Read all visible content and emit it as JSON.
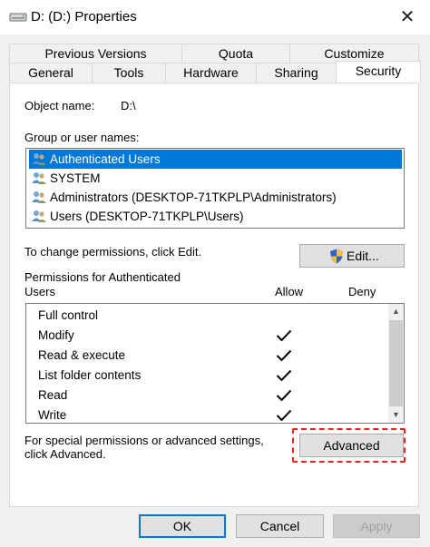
{
  "window": {
    "title": "D: (D:) Properties",
    "close_label": "✕"
  },
  "tabs": {
    "row1": [
      {
        "label": "Previous Versions"
      },
      {
        "label": "Quota"
      },
      {
        "label": "Customize"
      }
    ],
    "row2": [
      {
        "label": "General"
      },
      {
        "label": "Tools"
      },
      {
        "label": "Hardware"
      },
      {
        "label": "Sharing"
      },
      {
        "label": "Security"
      }
    ]
  },
  "security": {
    "object_name_label": "Object name:",
    "object_name_value": "D:\\",
    "group_label": "Group or user names:",
    "users": [
      {
        "name": "Authenticated Users",
        "selected": true
      },
      {
        "name": "SYSTEM",
        "selected": false
      },
      {
        "name": "Administrators (DESKTOP-71TKPLP\\Administrators)",
        "selected": false
      },
      {
        "name": "Users (DESKTOP-71TKPLP\\Users)",
        "selected": false
      }
    ],
    "change_hint": "To change permissions, click Edit.",
    "edit_label": "Edit...",
    "perm_label_line1": "Permissions for Authenticated",
    "perm_label_line2": "Users",
    "allow_header": "Allow",
    "deny_header": "Deny",
    "permissions": [
      {
        "name": "Full control",
        "allow": false
      },
      {
        "name": "Modify",
        "allow": true
      },
      {
        "name": "Read & execute",
        "allow": true
      },
      {
        "name": "List folder contents",
        "allow": true
      },
      {
        "name": "Read",
        "allow": true
      },
      {
        "name": "Write",
        "allow": true
      }
    ],
    "advanced_hint_line1": "For special permissions or advanced settings,",
    "advanced_hint_line2": "click Advanced.",
    "advanced_label": "Advanced"
  },
  "footer": {
    "ok_label": "OK",
    "cancel_label": "Cancel",
    "apply_label": "Apply"
  },
  "colors": {
    "selection": "#0078d7",
    "highlight_dash": "#e8231b"
  }
}
